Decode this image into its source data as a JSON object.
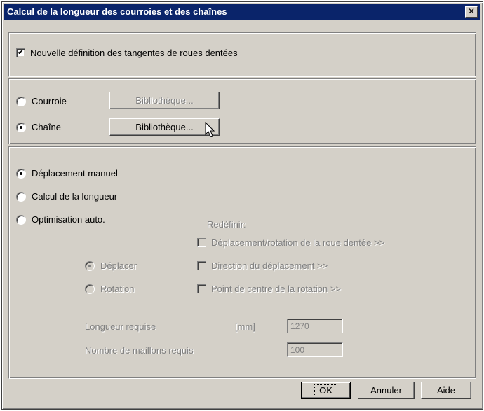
{
  "window": {
    "title": "Calcul de la longueur des courroies et des chaînes",
    "close_label": "✕"
  },
  "tangent": {
    "label": "Nouvelle définition des tangentes de roues dentées",
    "checked": true
  },
  "type_group": {
    "courroie_label": "Courroie",
    "chaine_label": "Chaîne",
    "library_label": "Bibliothèque..."
  },
  "mode_group": {
    "deplacement_label": "Déplacement manuel",
    "calcul_label": "Calcul de la longueur",
    "optimisation_label": "Optimisation auto.",
    "redefinir_label": "Redéfinir:",
    "redef_items": [
      "Déplacement/rotation de la roue dentée >>",
      "Direction du déplacement >>",
      "Point de centre de la rotation >>"
    ],
    "deplacer_label": "Déplacer",
    "rotation_label": "Rotation",
    "longueur_label": "Longueur requise",
    "unit_label": "[mm]",
    "longueur_value": "1270",
    "maillons_label": "Nombre de maillons requis",
    "maillons_value": "100"
  },
  "buttons": {
    "ok": "OK",
    "annuler": "Annuler",
    "aide": "Aide"
  }
}
